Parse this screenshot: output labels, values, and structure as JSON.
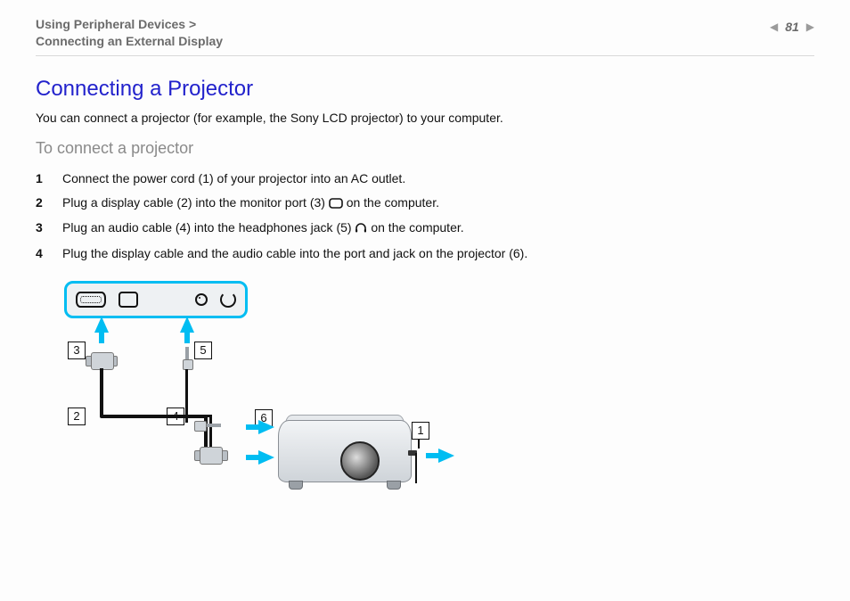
{
  "header": {
    "breadcrumb_line1": "Using Peripheral Devices >",
    "breadcrumb_line2": "Connecting an External Display",
    "page_number": "81"
  },
  "title": "Connecting a Projector",
  "intro": "You can connect a projector (for example, the Sony LCD projector) to your computer.",
  "subhead": "To connect a projector",
  "steps": [
    {
      "pre": "Connect the power cord (1) of your projector into an AC outlet.",
      "icon": null,
      "post": ""
    },
    {
      "pre": "Plug a display cable (2) into the monitor port (3) ",
      "icon": "monitor-port-icon",
      "post": " on the computer."
    },
    {
      "pre": "Plug an audio cable (4) into the headphones jack (5) ",
      "icon": "headphones-icon",
      "post": " on the computer."
    },
    {
      "pre": "Plug the display cable and the audio cable into the port and jack on the projector (6).",
      "icon": null,
      "post": ""
    }
  ],
  "diagram": {
    "callouts": {
      "c1": "1",
      "c2": "2",
      "c3": "3",
      "c4": "4",
      "c5": "5",
      "c6": "6"
    }
  }
}
